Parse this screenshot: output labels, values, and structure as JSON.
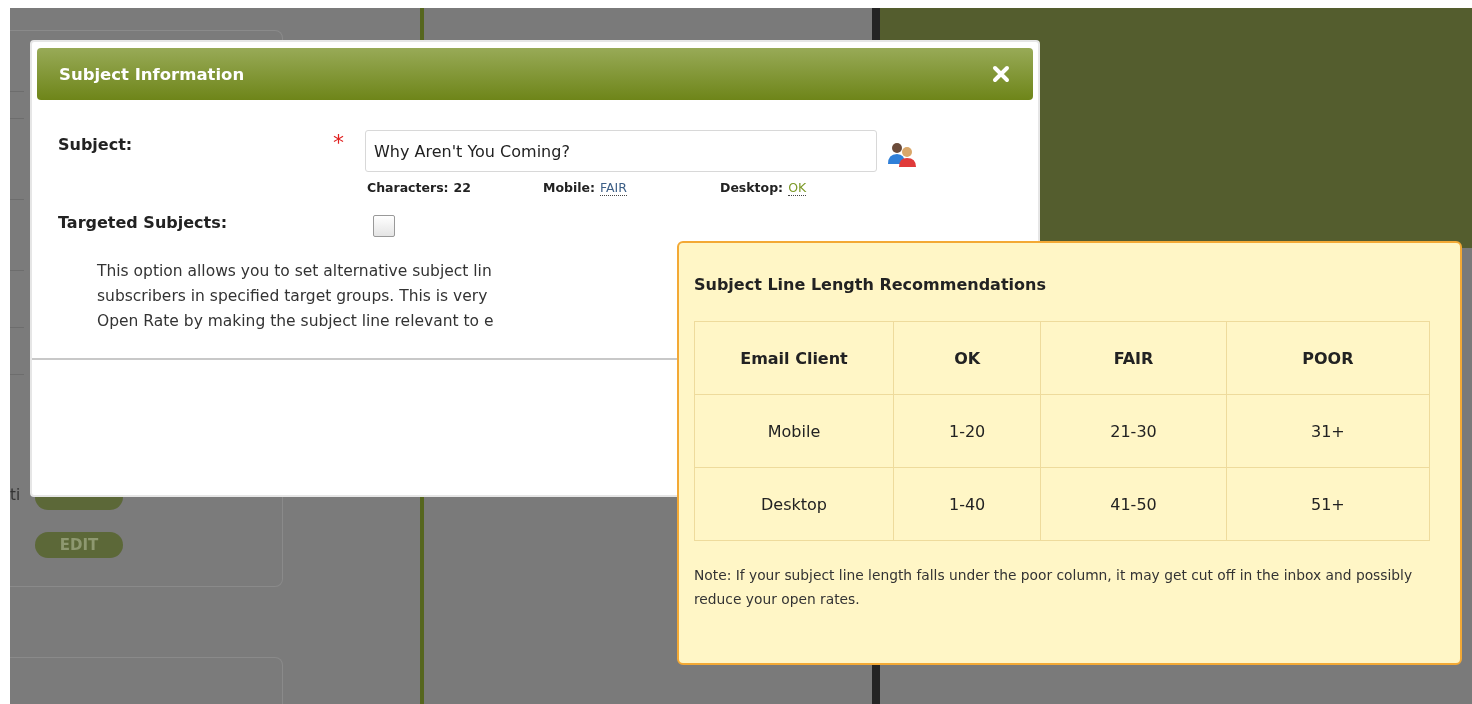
{
  "background": {
    "fragment": "ti",
    "edit_buttons": [
      "EDIT"
    ]
  },
  "dialog": {
    "title": "Subject Information",
    "subject": {
      "label": "Subject:",
      "required": "*",
      "value": "Why Aren't You Coming?",
      "stats": [
        {
          "label": "Characters:",
          "value": "22",
          "kind": "plain"
        },
        {
          "label": "Mobile:",
          "value": "FAIR",
          "kind": "rating",
          "color": "#3d5f86"
        },
        {
          "label": "Desktop:",
          "value": "OK",
          "kind": "rating",
          "color": "#7d9a2a"
        }
      ]
    },
    "targeted": {
      "label": "Targeted Subjects:",
      "checked": false
    },
    "description": [
      "This option allows you to set alternative subject lin",
      "subscribers in specified target groups. This is very",
      "Open Rate by making the subject line relevant to e"
    ]
  },
  "tooltip": {
    "title": "Subject Line Length Recommendations",
    "columns": [
      "Email Client",
      "OK",
      "FAIR",
      "POOR"
    ],
    "rows": [
      [
        "Mobile",
        "1-20",
        "21-30",
        "31+"
      ],
      [
        "Desktop",
        "1-40",
        "41-50",
        "51+"
      ]
    ],
    "note": "Note: If your subject line length falls under the poor column, it may get cut off in the inbox and possibly reduce your open rates."
  }
}
